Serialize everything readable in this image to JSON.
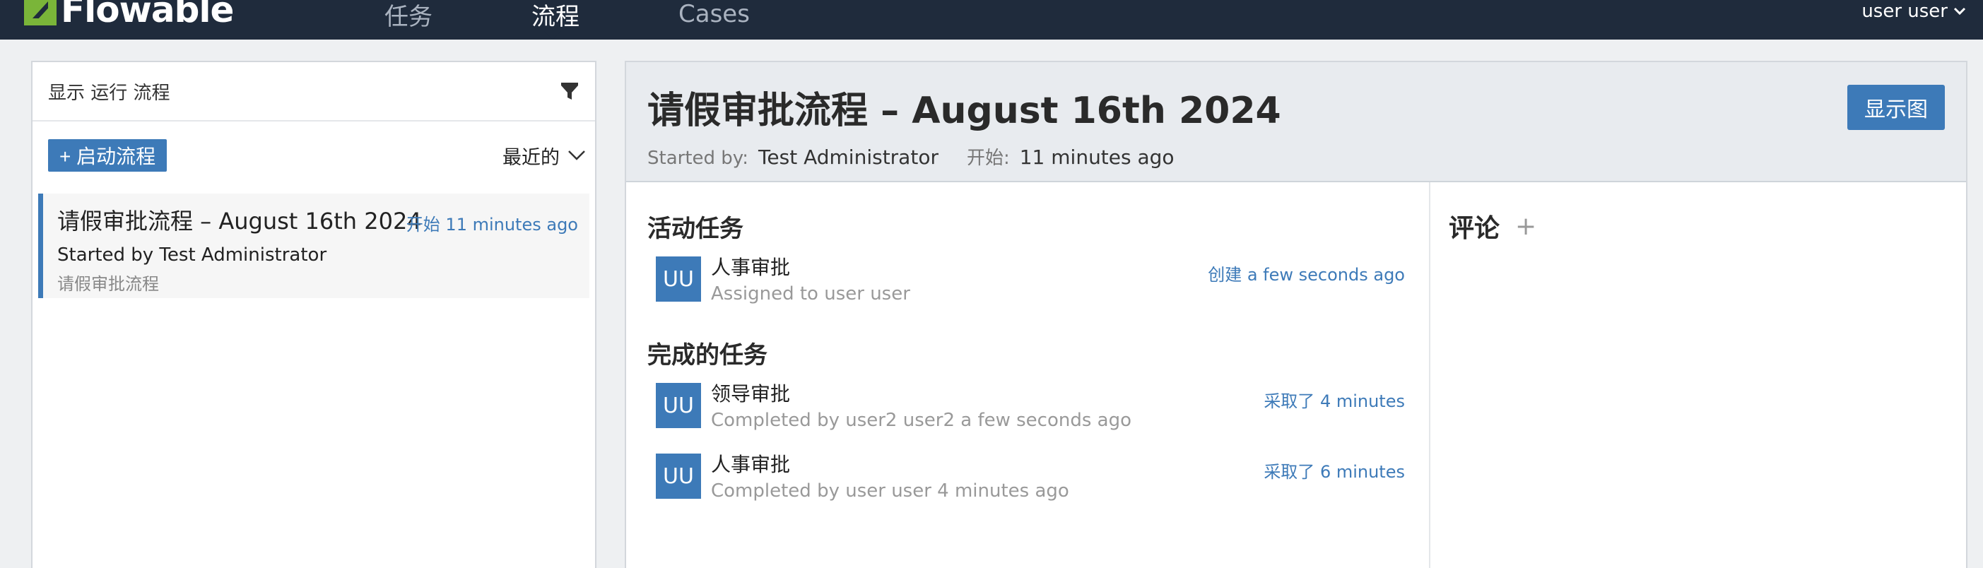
{
  "nav": {
    "brand": "Flowable",
    "items": [
      {
        "label": "任务"
      },
      {
        "label": "流程"
      },
      {
        "label": "Cases"
      }
    ],
    "user": "user user",
    "accent": "#7ab539",
    "background": "#1f2b3c"
  },
  "left_panel": {
    "title": "显示 运行 流程",
    "start_button": "+ 启动流程",
    "sort": "最近的",
    "process": {
      "title": "请假审批流程 – August 16th 2024",
      "time": "开始 11 minutes ago",
      "starter": "Started by Test Administrator",
      "definition": "请假审批流程"
    }
  },
  "detail": {
    "title": "请假审批流程 – August 16th 2024",
    "started_by_label": "Started by:",
    "started_by": "Test Administrator",
    "start_label": "开始:",
    "start_time": "11 minutes ago",
    "show_diagram": "显示图",
    "active_title": "活动任务",
    "active_tasks": [
      {
        "avatar": "UU",
        "name": "人事审批",
        "sub": "Assigned to user user",
        "time": "创建 a few seconds ago"
      }
    ],
    "completed_title": "完成的任务",
    "completed_tasks": [
      {
        "avatar": "UU",
        "name": "领导审批",
        "sub": "Completed by user2 user2 a few seconds ago",
        "time": "采取了 4 minutes"
      },
      {
        "avatar": "UU",
        "name": "人事审批",
        "sub": "Completed by user user 4 minutes ago",
        "time": "采取了 6 minutes"
      }
    ],
    "comments_title": "评论",
    "add_icon": "plus-icon"
  },
  "colors": {
    "primary": "#3d7ab8",
    "header_bg": "#e8ebef"
  }
}
